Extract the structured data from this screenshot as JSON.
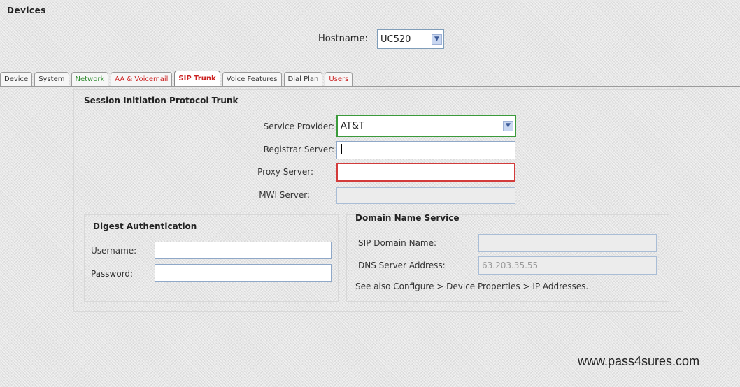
{
  "page": {
    "title": "Devices"
  },
  "hostname": {
    "label": "Hostname:",
    "value": "UC520"
  },
  "tabs": [
    {
      "label": "Device"
    },
    {
      "label": "System"
    },
    {
      "label": "Network"
    },
    {
      "label": "AA & Voicemail"
    },
    {
      "label": "SIP Trunk"
    },
    {
      "label": "Voice Features"
    },
    {
      "label": "Dial Plan"
    },
    {
      "label": "Users"
    }
  ],
  "sip": {
    "title": "Session Initiation Protocol Trunk",
    "service_provider": {
      "label": "Service Provider:",
      "value": "AT&T"
    },
    "registrar_server": {
      "label": "Registrar Server:",
      "value": ""
    },
    "proxy_server": {
      "label": "Proxy Server:",
      "value": ""
    },
    "mwi_server": {
      "label": "MWI Server:",
      "value": ""
    }
  },
  "digest": {
    "title": "Digest Authentication",
    "username": {
      "label": "Username:",
      "value": ""
    },
    "password": {
      "label": "Password:",
      "value": ""
    }
  },
  "dns": {
    "title": "Domain Name Service",
    "sip_domain": {
      "label": "SIP Domain Name:",
      "value": ""
    },
    "dns_server": {
      "label": "DNS Server Address:",
      "value": "63.203.35.55"
    },
    "note": "See also Configure > Device Properties > IP Addresses."
  },
  "watermark": "www.pass4sures.com",
  "colors": {
    "active_tab": "#cc2222",
    "green_tab": "#2e8b2e",
    "error_border": "#d33b3b",
    "focus_border": "#3a9a3a"
  }
}
